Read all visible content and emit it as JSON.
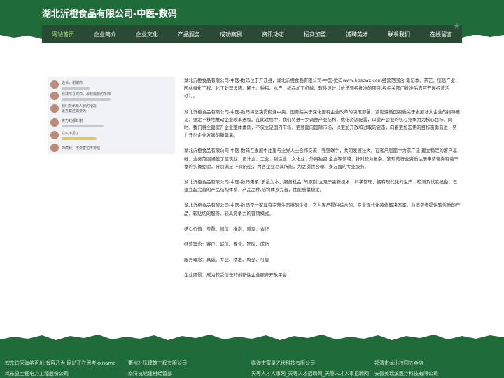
{
  "header": {
    "site_title": "湖北沂橙食品有限公司-中医-数码"
  },
  "nav": {
    "items": [
      {
        "label": "网站首页",
        "active": true
      },
      {
        "label": "企业简介"
      },
      {
        "label": "企业文化"
      },
      {
        "label": "产品服务"
      },
      {
        "label": "成功案例"
      },
      {
        "label": "资讯动态"
      },
      {
        "label": "招商加盟"
      },
      {
        "label": "诚聘英才"
      },
      {
        "label": "联系我们"
      },
      {
        "label": "在线留言"
      }
    ]
  },
  "content": {
    "paragraphs": [
      "湖北沂橙食品有限公司-中医-数码位于开江县，湖北沂橙食品有限公司-中医-数码www.hbscwz.com经营范围含:笔记本、茶艺、信息产业、园林绿化工程、化工处理设施、稀土、种猪、水产、纸品加工机械、软件设计（依法须经批准的项目,经相关部门批准后方可开展经营活动）。。",
      "湖北沂橙食品有限公司-中医-数码将坚决贯彻党中央、国务院关于深化国有企业改革的决策部署，紧密遵循国资委关于发展壮大企业的指导意见，坚定不移地推动企业改革进程。在此过程中，我们将进一步调整产业结构，优化资源配置，以提升企业的核心竞争力为核心目标。同时，我们将全面提升企业整体素质，不仅立足国内市场，更要面向国际市场，以更加开放和进取的姿态，向着更加宏伟的目标奋勇前进，努力开创企业发展的新篇章。",
      "湖北沂橙食品有限公司-中医-数码在发展中注重与业界人士合作交流，强强联手，共同发展壮大。在客户层面中力求广泛 建立稳定的客户基础，业务范围涵盖了建筑业、设计业、工业、制造业、文化业、外商独资 企业等领域，针对较为复杂、繁琐的行业资质注册申请咨询有着丰富的实操经验，分别满足 不同行业，为各企业尽其所能，为之提供合理、多方面的专业服务。",
      "湖北沂橙食品有限公司-中医-数码秉承“质量为本，服务社会”的原则,立足于高新技术，科学管理，拥有现代化的生产、检测及试验设备，已建立起完善的产品结构体系，产品品种,结构体系完善，性能质量稳定。",
      "湖北沂橙食品有限公司-中医-数码是一家具有完整生态链的企业，它为客户提供综合的、专业现代化装修解决方案。为消费者提供较优质的产品、较贴切的服务、较具竞争力的营销模式。",
      "核心价值：尊重、诚信、推崇、感恩、合作",
      "经营理念：客户、诚信、专业、团队、成功",
      "服务理念：真诚、专业、精准、周全、可靠",
      "企业愿景：成为较受信任的创新性企业服务开放平台"
    ]
  },
  "thumbnail": {
    "rows": [
      {
        "text": "选长，谢谢你"
      },
      {
        "text": "我非常喜欢你，那我需要的东西"
      },
      {
        "text": "我们技术新人我的朋友"
      },
      {
        "text": "最方案还需要的"
      },
      {
        "text": "实力效都有谢"
      },
      {
        "text": "好久不见了"
      },
      {
        "text": "的确我，不要害怕不要怕"
      }
    ]
  },
  "footer": {
    "links": [
      "欢东访问海纳百川,有容乃大,网站正在思考xxname",
      "衢州朴乐建筑工程有限公司",
      "临海市富星光伏科技有限公司",
      "福清市龙山校园五金店",
      "鸡东县圭便电力工程股份公司",
      "南浔杭旭建材经营部",
      "天等人才人事网_天等人才招聘网_天等人才人事招聘网",
      "安徽美瑞滨医疗科技有限公司"
    ]
  },
  "colors": {
    "brand_green": "#1f6b3a",
    "nav_bg": "#2b4a36",
    "active_nav": "#9be26a"
  }
}
